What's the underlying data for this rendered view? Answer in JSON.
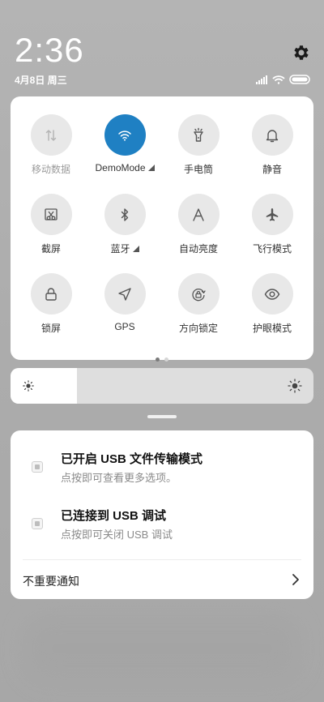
{
  "status": {
    "time": "2:36",
    "date": "4月8日 周三"
  },
  "quick_settings": {
    "tiles": [
      {
        "label": "移动数据",
        "icon": "mobile-data-icon",
        "active": false
      },
      {
        "label": "DemoMode",
        "icon": "wifi-icon",
        "active": true
      },
      {
        "label": "手电筒",
        "icon": "flashlight-icon",
        "active": false
      },
      {
        "label": "静音",
        "icon": "bell-icon",
        "active": false
      },
      {
        "label": "截屏",
        "icon": "screenshot-icon",
        "active": false
      },
      {
        "label": "蓝牙",
        "icon": "bluetooth-icon",
        "active": false
      },
      {
        "label": "自动亮度",
        "icon": "auto-brightness-icon",
        "active": false
      },
      {
        "label": "飞行模式",
        "icon": "airplane-icon",
        "active": false
      },
      {
        "label": "锁屏",
        "icon": "lock-icon",
        "active": false
      },
      {
        "label": "GPS",
        "icon": "location-icon",
        "active": false
      },
      {
        "label": "方向锁定",
        "icon": "rotation-lock-icon",
        "active": false
      },
      {
        "label": "护眼模式",
        "icon": "eye-icon",
        "active": false
      }
    ],
    "page_count": 2,
    "current_page": 1
  },
  "brightness": {
    "level": 0.22
  },
  "notifications": {
    "items": [
      {
        "title": "已开启 USB 文件传输模式",
        "subtitle": "点按即可查看更多选项。"
      },
      {
        "title": "已连接到 USB 调试",
        "subtitle": "点按即可关闭 USB 调试"
      }
    ],
    "more_label": "不重要通知"
  },
  "colors": {
    "accent": "#1f80c3",
    "tile_bg": "#e8e8e8",
    "panel_bg": "#ffffff"
  }
}
